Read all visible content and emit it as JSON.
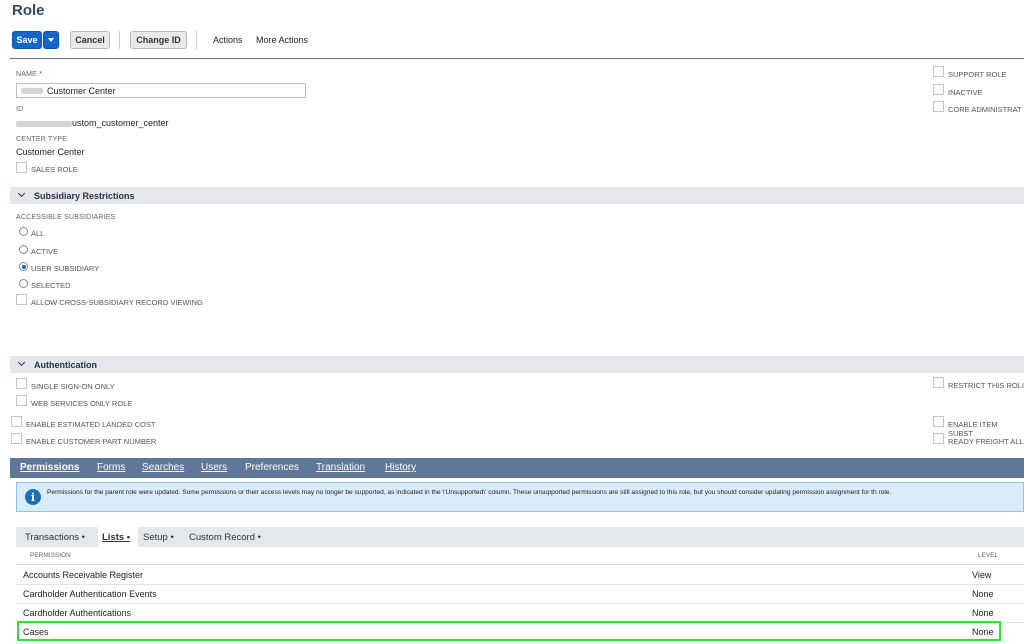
{
  "page": {
    "title": "Role"
  },
  "toolbar": {
    "save_label": "Save",
    "cancel_label": "Cancel",
    "change_id_label": "Change ID",
    "actions_label": "Actions",
    "more_actions_label": "More Actions"
  },
  "fields": {
    "name_label": "NAME",
    "required_mark": "*",
    "name_value": "Customer Center",
    "id_label": "ID",
    "id_value": "ustom_customer_center",
    "center_type_label": "CENTER TYPE",
    "center_type_value": "Customer Center",
    "sales_role_label": "SALES ROLE",
    "support_role_label": "SUPPORT ROLE",
    "inactive_label": "INACTIVE",
    "core_admin_label": "CORE ADMINISTRAT"
  },
  "subsidiary": {
    "section_title": "Subsidiary Restrictions",
    "accessible_label": "ACCESSIBLE SUBSIDIARIES",
    "options": [
      "ALL",
      "ACTIVE",
      "USER SUBSIDIARY",
      "SELECTED"
    ],
    "selected_option": "USER SUBSIDIARY",
    "cross_view_label": "ALLOW CROSS-SUBSIDIARY RECORD VIEWING"
  },
  "authentication": {
    "section_title": "Authentication",
    "sso_label": "SINGLE SIGN-ON ONLY",
    "ws_label": "WEB SERVICES ONLY ROLE",
    "landed_cost_label": "ENABLE ESTIMATED LANDED COST",
    "customer_part_label": "ENABLE CUSTOMER PART NUMBER",
    "restrict_label": "RESTRICT THIS ROLI",
    "item_subst_label": "ENABLE ITEM SUBST",
    "ready_freight_label": "READY FREIGHT ALL"
  },
  "tabs": [
    "Permissions",
    "Forms",
    "Searches",
    "Users",
    "Preferences",
    "Translation",
    "History"
  ],
  "notice": {
    "text": "Permissions for the parent role were updated. Some permissions or their access levels may no longer be supported, as indicated in the \\'Unsupported\\' column. These unsupported permissions are still assigned to this role, but you should consider updating permission assignment for th role."
  },
  "subtabs": [
    "Transactions •",
    "Lists •",
    "Setup •",
    "Custom Record •"
  ],
  "table": {
    "col_permission": "PERMISSION",
    "col_level": "LEVEL",
    "rows": [
      {
        "permission": "Accounts Receivable Register",
        "level": "View"
      },
      {
        "permission": "Cardholder Authentication Events",
        "level": "None"
      },
      {
        "permission": "Cardholder Authentications",
        "level": "None"
      },
      {
        "permission": "Cases",
        "level": "None"
      }
    ]
  },
  "colors": {
    "primary": "#1266cc",
    "tabbar": "#607799",
    "highlight": "#33e133",
    "title": "#2e4a6b"
  }
}
